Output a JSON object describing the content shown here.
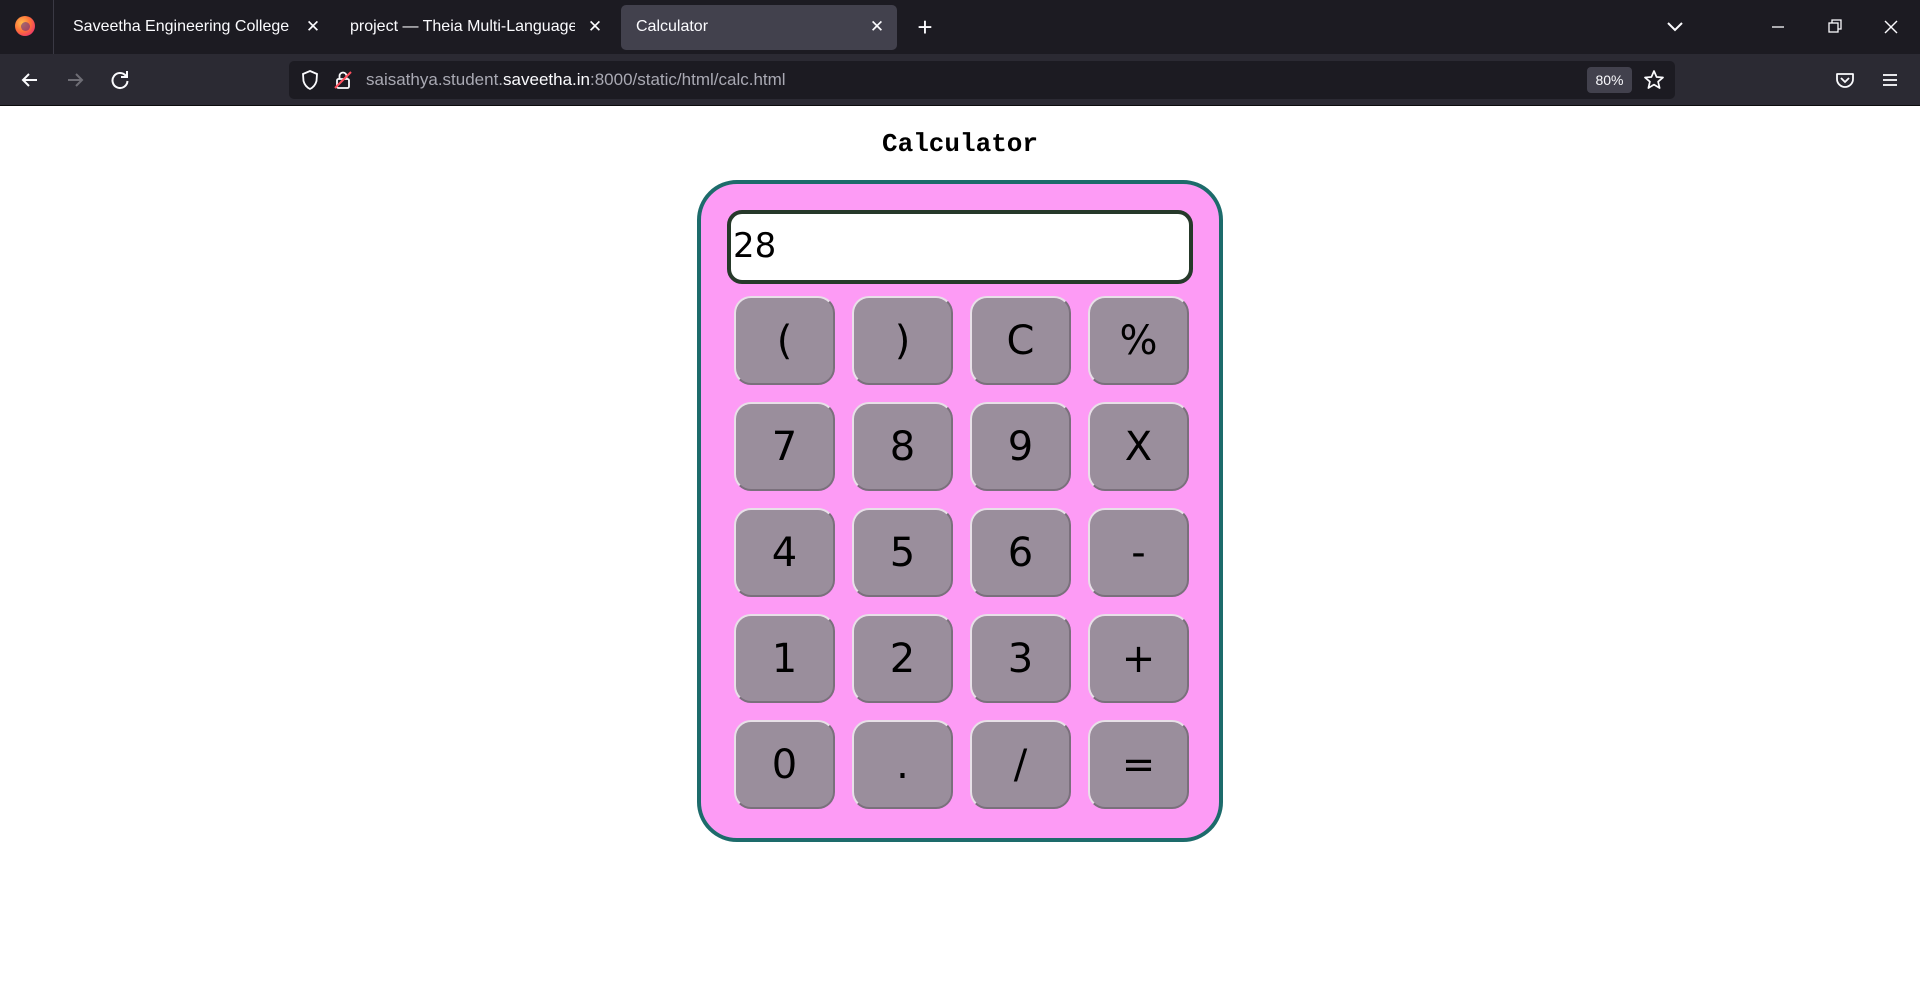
{
  "browser": {
    "tabs": [
      {
        "title": "Saveetha Engineering College",
        "active": false
      },
      {
        "title": "project — Theia Multi-Language Ex",
        "active": false
      },
      {
        "title": "Calculator",
        "active": true
      }
    ],
    "url": {
      "prefix": "saisathya.student.",
      "host": "saveetha.in",
      "suffix": ":8000/static/html/calc.html"
    },
    "zoom": "80%"
  },
  "page": {
    "title": "Calculator",
    "display_value": "28",
    "keys": [
      "(",
      ")",
      "C",
      "%",
      "7",
      "8",
      "9",
      "X",
      "4",
      "5",
      "6",
      "-",
      "1",
      "2",
      "3",
      "+",
      "0",
      ".",
      "/",
      "="
    ]
  },
  "colors": {
    "calculator_body": "#fd9bf5",
    "calculator_border": "#1d6b6b",
    "key_background": "#9a8e9c",
    "display_border": "#26392a"
  }
}
